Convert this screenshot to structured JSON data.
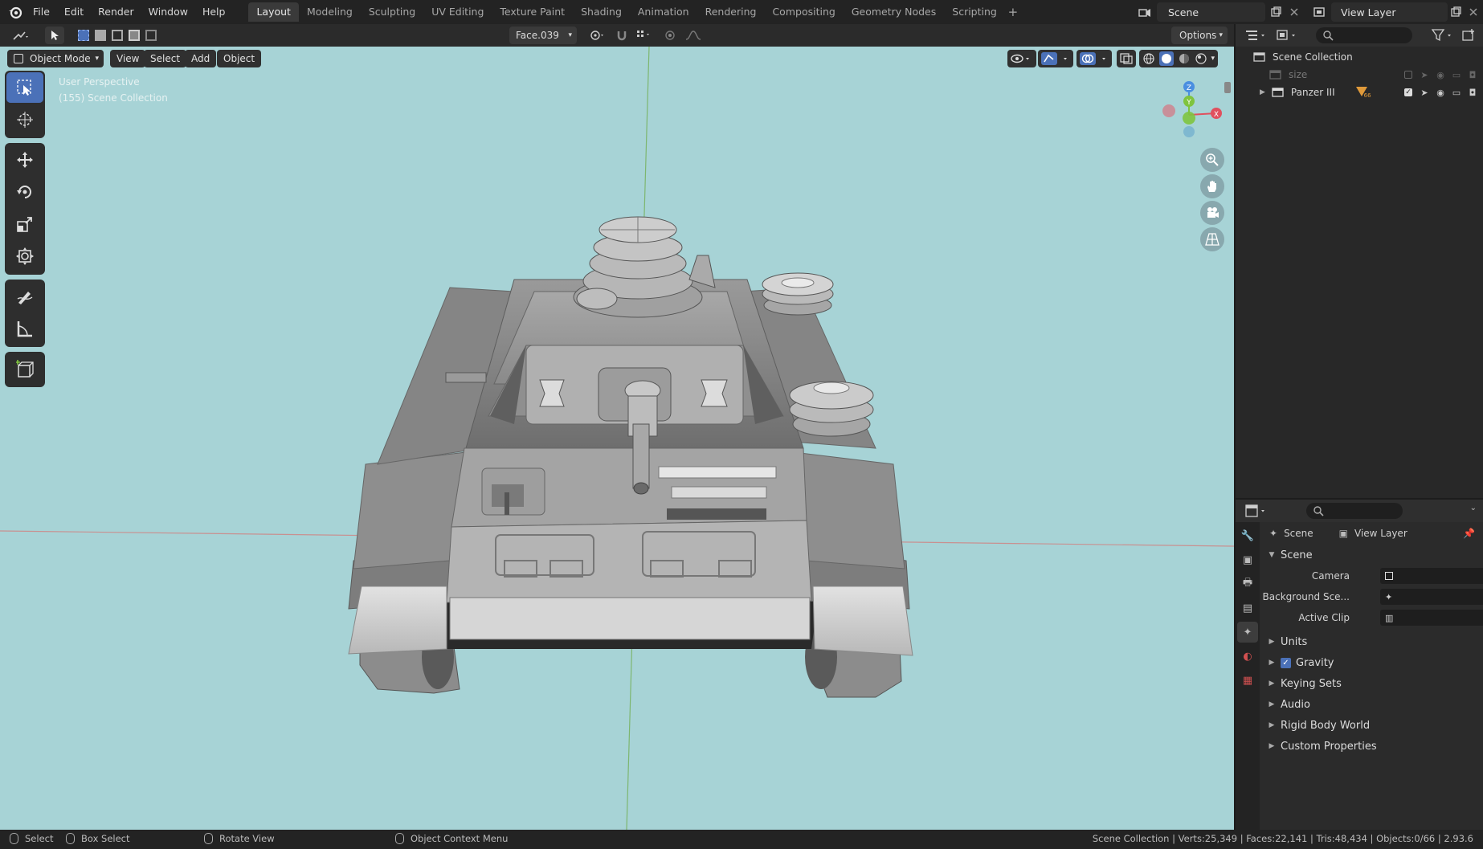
{
  "menu": {
    "items": [
      "File",
      "Edit",
      "Render",
      "Window",
      "Help"
    ]
  },
  "workspaces": {
    "tabs": [
      "Layout",
      "Modeling",
      "Sculpting",
      "UV Editing",
      "Texture Paint",
      "Shading",
      "Animation",
      "Rendering",
      "Compositing",
      "Geometry Nodes",
      "Scripting"
    ],
    "active": "Layout"
  },
  "scene_selector": {
    "value": "Scene"
  },
  "view_layer_selector": {
    "value": "View Layer"
  },
  "tool_header": {
    "transform_orientation": "Face.039",
    "options_label": "Options"
  },
  "viewport_header": {
    "mode": "Object Mode",
    "view": "View",
    "select": "Select",
    "add": "Add",
    "object": "Object"
  },
  "viewport_info": {
    "perspective": "User Perspective",
    "collection": "(155) Scene Collection"
  },
  "gizmo": {
    "z": "Z",
    "y": "Y",
    "x": "X"
  },
  "outliner": {
    "root": "Scene Collection",
    "items": [
      {
        "name": "size",
        "dimmed": true
      },
      {
        "name": "Panzer III",
        "dimmed": false,
        "badge": "66"
      }
    ]
  },
  "properties": {
    "breadcrumb_scene": "Scene",
    "breadcrumb_view_layer": "View Layer",
    "scene_panel": "Scene",
    "fields": [
      {
        "label": "Camera"
      },
      {
        "label": "Background Sce..."
      },
      {
        "label": "Active Clip"
      }
    ],
    "subpanels": [
      "Units",
      "Gravity",
      "Keying Sets",
      "Audio",
      "Rigid Body World",
      "Custom Properties"
    ]
  },
  "statusbar": {
    "select": "Select",
    "box_select": "Box Select",
    "rotate_view": "Rotate View",
    "context_menu": "Object Context Menu",
    "stats": "Scene Collection | Verts:25,349 | Faces:22,141 | Tris:48,434 | Objects:0/66 | 2.93.6"
  },
  "colors": {
    "viewport_bg": "#a7d3d6",
    "accent": "#4b71b8",
    "axis_x": "#e0505e",
    "axis_y": "#7fc43f",
    "axis_z": "#4a8ee0"
  }
}
